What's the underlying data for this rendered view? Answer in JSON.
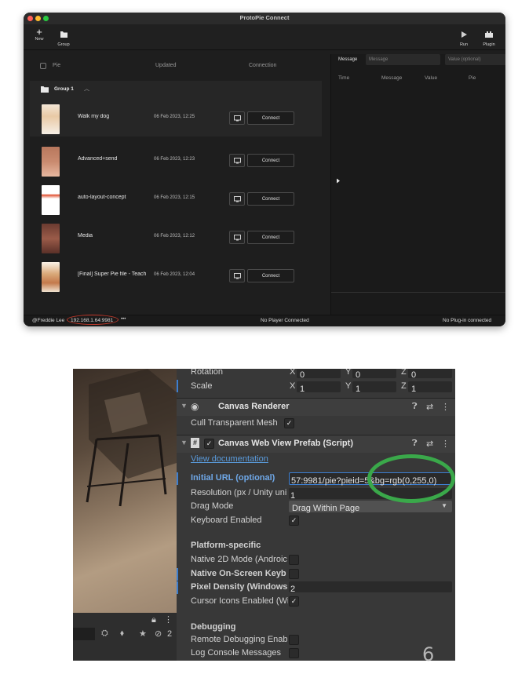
{
  "window": {
    "title": "ProtoPie Connect",
    "toolbar": {
      "new_label": "New",
      "group_label": "Group",
      "run_label": "Run",
      "plugin_label": "Plugin"
    },
    "columns": {
      "pie": "Pie",
      "updated": "Updated",
      "connection": "Connection"
    },
    "group": {
      "name": "Group 1"
    },
    "pies": [
      {
        "name": "Walk my dog",
        "updated": "06 Feb 2023, 12:25",
        "connect": "Connect"
      },
      {
        "name": "Advanced+send",
        "updated": "06 Feb 2023, 12:23",
        "connect": "Connect"
      },
      {
        "name": "auto-layout-concept",
        "updated": "06 Feb 2023, 12:15",
        "connect": "Connect"
      },
      {
        "name": "Media",
        "updated": "06 Feb 2023, 12:12",
        "connect": "Connect"
      },
      {
        "name": "[Final] Super Pie file - Teach",
        "updated": "06 Feb 2023, 12:04",
        "connect": "Connect"
      }
    ],
    "message_panel": {
      "label": "Message",
      "message_placeholder": "Message",
      "value_placeholder": "Value (optional)",
      "headers": [
        "Time",
        "Message",
        "Value",
        "Pie"
      ]
    },
    "status": {
      "user": "@Freddie Lee",
      "ip": "192.168.1.64:9981",
      "more": "•••",
      "player": "No Player Connected",
      "plugin": "No Plug-in connected"
    }
  },
  "inspector": {
    "transform": {
      "rotation_label": "Rotation",
      "scale_label": "Scale",
      "rotation": {
        "x": "0",
        "y": "0",
        "z": "0"
      },
      "scale": {
        "x": "1",
        "y": "1",
        "z": "1"
      },
      "axis": {
        "x": "X",
        "y": "Y",
        "z": "Z"
      }
    },
    "canvas_renderer": {
      "title": "Canvas Renderer",
      "cull_label": "Cull Transparent Mesh"
    },
    "webview": {
      "title": "Canvas Web View Prefab (Script)",
      "doc_link": "View documentation",
      "initial_url_label": "Initial URL (optional)",
      "initial_url_value": "57:9981/pie?pieid=5&bg=rgb(0,255,0)",
      "resolution_label": "Resolution (px / Unity uni",
      "resolution_value": "1",
      "drag_mode_label": "Drag Mode",
      "drag_mode_value": "Drag Within Page",
      "keyboard_label": "Keyboard Enabled",
      "platform_header": "Platform-specific",
      "native2d_label": "Native 2D Mode (Androic",
      "native_keyboard_label": "Native On-Screen Keyb",
      "pixel_density_label": "Pixel Density (Windows",
      "pixel_density_value": "2",
      "cursor_icons_label": "Cursor Icons Enabled (Wi",
      "debugging_header": "Debugging",
      "remote_debug_label": "Remote Debugging Enab",
      "log_console_label": "Log Console Messages"
    },
    "scene_toolbar": {
      "badge": "2"
    }
  },
  "page_number": "6",
  "colors": {
    "annotation_red": "#c0392b",
    "annotation_green": "#3aa84a",
    "unity_link": "#5a9bdc"
  }
}
